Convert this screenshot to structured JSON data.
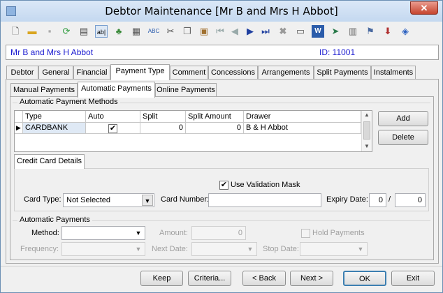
{
  "window": {
    "title": "Debtor Maintenance  [Mr B and Mrs H Abbot]",
    "close_glyph": "✕"
  },
  "toolbar": {
    "icons": [
      "new-icon",
      "open-icon",
      "save-icon",
      "refresh-icon",
      "print-icon",
      "field-icon",
      "tree-icon",
      "calculator-icon",
      "spellcheck-icon",
      "cut-icon",
      "copy-icon",
      "paste-icon",
      "first-icon",
      "prev-icon",
      "next-icon",
      "last-icon",
      "delete-icon",
      "card-icon",
      "word-icon",
      "forward-icon",
      "clipboard-icon",
      "stamp-icon",
      "download-icon",
      "tag-icon"
    ]
  },
  "debtor": {
    "name": "Mr B and Mrs H Abbot",
    "id_label": "ID: 11001"
  },
  "main_tabs": [
    "Debtor",
    "General",
    "Financial",
    "Payment Type",
    "Comment",
    "Concessions",
    "Arrangements",
    "Split Payments",
    "Instalments"
  ],
  "active_main_tab": "Payment Type",
  "sub_tabs": [
    "Manual Payments",
    "Automatic Payments",
    "Online Payments"
  ],
  "active_sub_tab": "Automatic Payments",
  "apm": {
    "label": "Automatic Payment Methods",
    "columns": [
      "Type",
      "Auto Payments",
      "Split Percent",
      "Split Amount",
      "Drawer"
    ],
    "rows": [
      {
        "type": "CARDBANK",
        "auto_payments": "✔",
        "split_percent": "0",
        "split_amount": "0",
        "drawer": "B & H Abbot"
      }
    ],
    "add_label": "Add",
    "delete_label": "Delete"
  },
  "card": {
    "tab_label": "Credit Card Details",
    "use_mask_label": "Use Validation Mask",
    "use_mask_checked": "✔",
    "card_type_label": "Card Type:",
    "card_type_value": "Not Selected",
    "card_number_label": "Card Number:",
    "card_number_value": "",
    "expiry_label": "Expiry Date:",
    "expiry_month": "0",
    "expiry_sep": "/",
    "expiry_year": "0"
  },
  "auto": {
    "label": "Automatic Payments",
    "method_label": "Method:",
    "amount_label": "Amount:",
    "amount_value": "0",
    "hold_label": "Hold Payments",
    "frequency_label": "Frequency:",
    "next_date_label": "Next Date:",
    "stop_date_label": "Stop Date:"
  },
  "footer": {
    "keep": "Keep",
    "criteria": "Criteria...",
    "back": "< Back",
    "next": "Next >",
    "ok": "OK",
    "exit": "Exit"
  }
}
